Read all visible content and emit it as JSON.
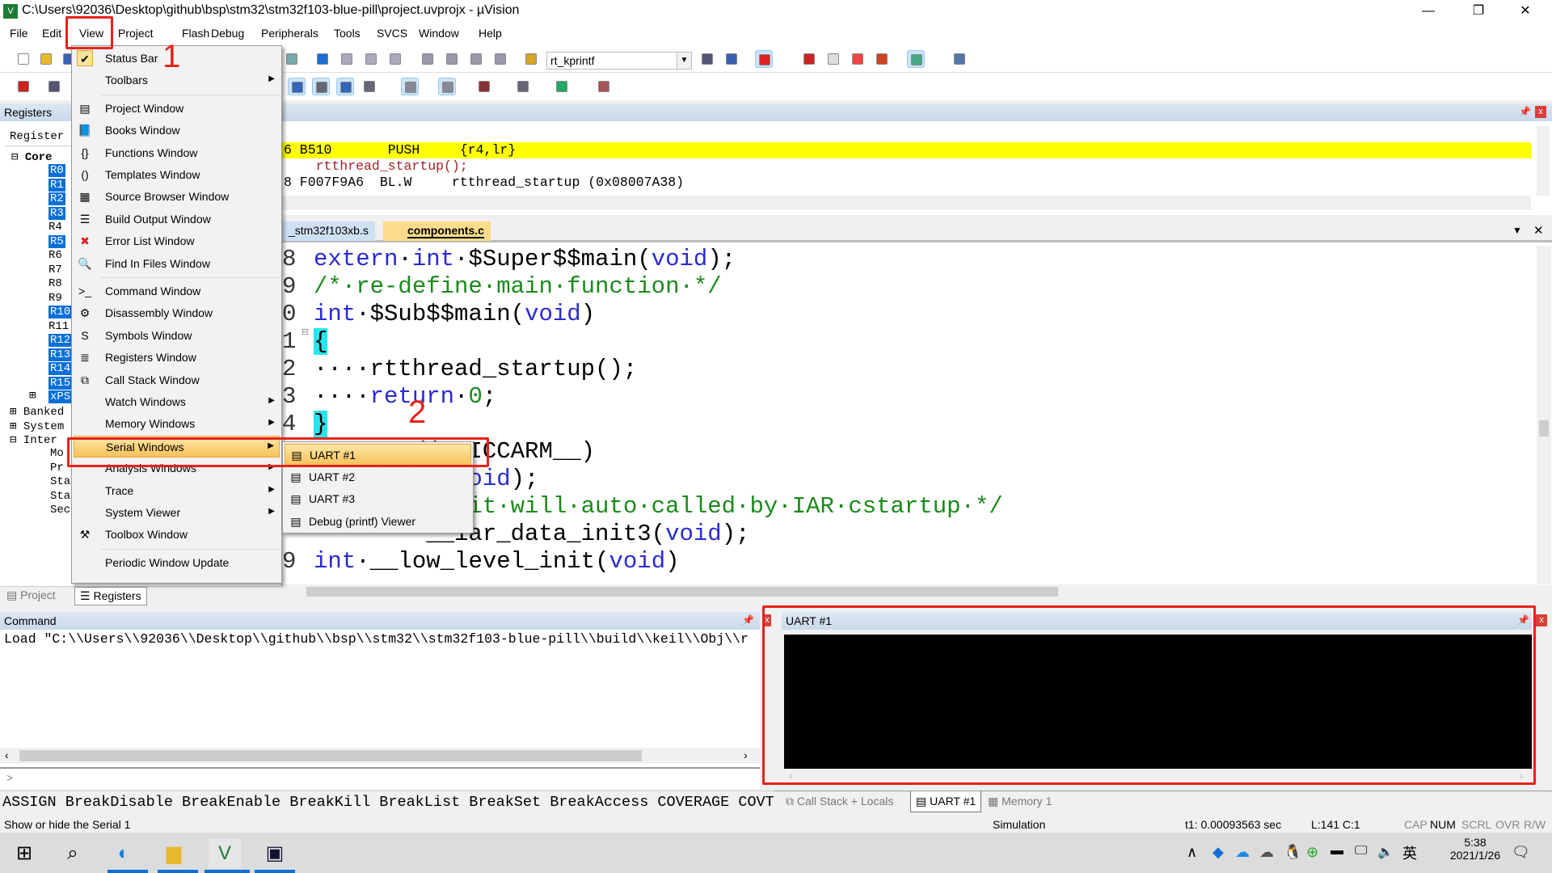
{
  "window": {
    "title": "C:\\Users\\92036\\Desktop\\github\\bsp\\stm32\\stm32f103-blue-pill\\project.uvprojx - µVision",
    "minimize": "—",
    "restore": "❐",
    "close": "✕"
  },
  "menubar": [
    "File",
    "Edit",
    "View",
    "Project",
    "Flash",
    "Debug",
    "Peripherals",
    "Tools",
    "SVCS",
    "Window",
    "Help"
  ],
  "toolbar": {
    "function_combo": "rt_kprintf"
  },
  "registers_panel": {
    "title": "Registers",
    "column": "Register",
    "core": "Core",
    "regs": [
      "R0",
      "R1",
      "R2",
      "R3",
      "R4",
      "R5",
      "R6",
      "R7",
      "R8",
      "R9",
      "R10",
      "R11",
      "R12",
      "R13",
      "R14",
      "R15",
      "xPSR"
    ],
    "highlighted": [
      "R0",
      "R1",
      "R2",
      "R3",
      "R5",
      "R10",
      "R12",
      "R13",
      "R14",
      "R15",
      "xPSR"
    ],
    "groups": [
      "Banked",
      "System",
      "Inter"
    ],
    "internal_children": [
      "Mo",
      "Pr",
      "Sta",
      "Sta",
      "Sec"
    ],
    "tabs": [
      "Project",
      "Registers"
    ]
  },
  "disassembly": {
    "lines": [
      "6 B510       PUSH     {r4,lr}",
      "    rtthread_startup();",
      "8 F007F9A6  BL.W     rtthread_startup (0x08007A38)"
    ],
    "highlight_color": "#ffff00"
  },
  "editor": {
    "tabs": [
      "_stm32f103xb.s",
      "components.c"
    ],
    "active_tab": "components.c",
    "lines": [
      {
        "n": "8",
        "parts": [
          [
            "kw",
            "extern"
          ],
          [
            "",
            "·"
          ],
          [
            "kw",
            "int"
          ],
          [
            "",
            "·$Super$$main("
          ],
          [
            "kw",
            "void"
          ],
          [
            "",
            ");"
          ]
        ]
      },
      {
        "n": "9",
        "parts": [
          [
            "cm",
            "/*·re-define·main·function·*/"
          ]
        ]
      },
      {
        "n": "0",
        "parts": [
          [
            "kw",
            "int"
          ],
          [
            "",
            "·$Sub$$main("
          ],
          [
            "kw",
            "void"
          ],
          [
            "",
            ")"
          ]
        ]
      },
      {
        "n": "1",
        "parts": [
          [
            "",
            "{"
          ]
        ]
      },
      {
        "n": "2",
        "parts": [
          [
            "",
            "····rtthread_startup();"
          ]
        ]
      },
      {
        "n": "3",
        "parts": [
          [
            "",
            "····"
          ],
          [
            "kw",
            "return"
          ],
          [
            "",
            "·"
          ],
          [
            "cm",
            "0"
          ],
          [
            "",
            ";"
          ]
        ]
      },
      {
        "n": "4",
        "parts": [
          [
            "",
            "}"
          ]
        ]
      },
      {
        "n": "",
        "parts": [
          [
            "",
            "      ed(__ICCARM__)"
          ]
        ]
      },
      {
        "n": "",
        "parts": [
          [
            "",
            "      ain("
          ],
          [
            "kw",
            "void"
          ],
          [
            "",
            ");"
          ]
        ]
      },
      {
        "n": "",
        "parts": [
          [
            "",
            "      "
          ],
          [
            "cm",
            "el_init·will·auto·called·by·IAR·cstartup·*/"
          ]
        ]
      },
      {
        "n": "",
        "parts": [
          [
            "",
            "        __iar_data_init3("
          ],
          [
            "kw",
            "void"
          ],
          [
            "",
            ");"
          ]
        ]
      },
      {
        "n": "9",
        "parts": [
          [
            "kw",
            "int"
          ],
          [
            "",
            "·__low_level_init("
          ],
          [
            "kw",
            "void"
          ],
          [
            "",
            ")"
          ]
        ]
      }
    ]
  },
  "view_menu": {
    "items": [
      {
        "label": "Status Bar",
        "icon": "check-icon",
        "checked": true
      },
      {
        "label": "Toolbars",
        "submenu": true
      },
      {
        "sep": true
      },
      {
        "label": "Project Window",
        "icon": "project-window-icon"
      },
      {
        "label": "Books Window",
        "icon": "books-icon"
      },
      {
        "label": "Functions Window",
        "icon": "braces-icon"
      },
      {
        "label": "Templates Window",
        "icon": "templates-icon"
      },
      {
        "label": "Source Browser Window",
        "icon": "source-browser-icon"
      },
      {
        "label": "Build Output Window",
        "icon": "build-output-icon"
      },
      {
        "label": "Error List Window",
        "icon": "error-x-icon"
      },
      {
        "label": "Find In Files Window",
        "icon": "find-in-files-icon"
      },
      {
        "sep": true
      },
      {
        "label": "Command Window",
        "icon": "command-window-icon"
      },
      {
        "label": "Disassembly Window",
        "icon": "disassembly-icon"
      },
      {
        "label": "Symbols Window",
        "icon": "symbols-icon"
      },
      {
        "label": "Registers Window",
        "icon": "registers-icon"
      },
      {
        "label": "Call Stack Window",
        "icon": "call-stack-icon"
      },
      {
        "label": "Watch Windows",
        "submenu": true
      },
      {
        "label": "Memory Windows",
        "submenu": true
      },
      {
        "label": "Serial Windows",
        "submenu": true,
        "selected": true
      },
      {
        "label": "Analysis Windows",
        "submenu": true
      },
      {
        "label": "Trace",
        "submenu": true
      },
      {
        "label": "System Viewer",
        "submenu": true
      },
      {
        "label": "Toolbox Window",
        "icon": "toolbox-icon"
      },
      {
        "sep": true
      },
      {
        "label": "Periodic Window Update"
      }
    ]
  },
  "serial_submenu": [
    {
      "label": "UART #1",
      "selected": true
    },
    {
      "label": "UART #2"
    },
    {
      "label": "UART #3"
    },
    {
      "label": "Debug (printf) Viewer"
    }
  ],
  "annotations": {
    "step1": "1",
    "step2": "2",
    "color": "#e5231b"
  },
  "command_panel": {
    "title": "Command",
    "output": "Load \"C:\\\\Users\\\\92036\\\\Desktop\\\\github\\\\bsp\\\\stm32\\\\stm32f103-blue-pill\\\\build\\\\keil\\\\Obj\\\\r",
    "prompt": ">",
    "hints": "ASSIGN BreakDisable BreakEnable BreakKill BreakList BreakSet BreakAccess COVERAGE COVTOFILE"
  },
  "uart_panel": {
    "title": "UART #1",
    "background": "#000000"
  },
  "bottom_tabs": [
    "Call Stack + Locals",
    "UART #1",
    "Memory 1"
  ],
  "statusbar": {
    "message": "Show or hide the Serial 1",
    "mode": "Simulation",
    "time": "t1: 0.00093563 sec",
    "position": "L:141 C:1",
    "indicators": [
      "CAP",
      "NUM",
      "SCRL",
      "OVR",
      "R/W"
    ]
  },
  "taskbar": {
    "time": "5:38",
    "date": "2021/1/26",
    "ime": "英"
  }
}
